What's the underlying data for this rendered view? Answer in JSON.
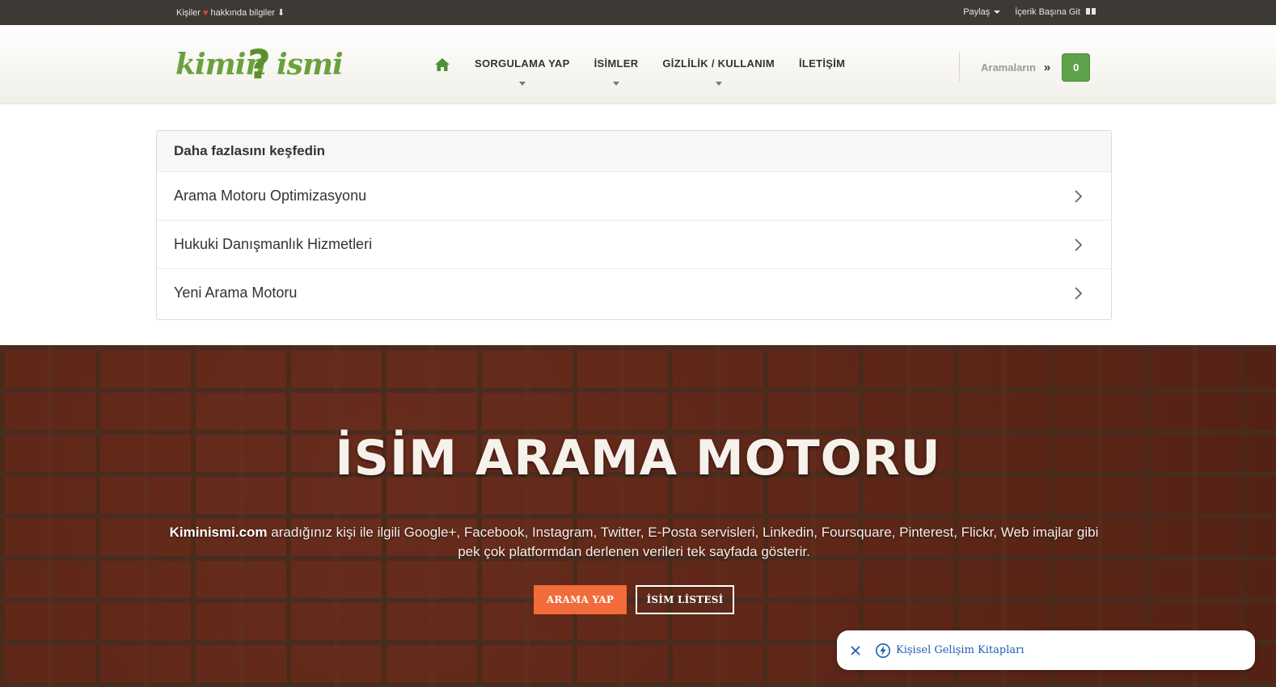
{
  "topbar": {
    "left_prefix": "Kişiler",
    "left_suffix": "hakkında bilgiler",
    "left_icon": "heart-icon",
    "left_arrow": "⬇",
    "share": "Paylaş",
    "go_top": "İçerik Başına Git",
    "go_top_icon": "book-icon"
  },
  "header": {
    "logo_left": "kimin",
    "logo_q": "?",
    "logo_right": "ismi",
    "nav": [
      {
        "label": "SORGULAMA YAP"
      },
      {
        "label": "İSİMLER"
      },
      {
        "label": "GİZLİLİK / KULLANIM"
      },
      {
        "label": "İLETİŞİM"
      }
    ],
    "searches_label": "Aramaların",
    "searches_raquo": "»",
    "searches_count": "0"
  },
  "discover": {
    "title": "Daha fazlasını keşfedin",
    "items": [
      {
        "label": "Arama Motoru Optimizasyonu"
      },
      {
        "label": "Hukuki Danışmanlık Hizmetleri"
      },
      {
        "label": "Yeni Arama Motoru"
      }
    ]
  },
  "hero": {
    "title": "İSİM ARAMA MOTORU",
    "brand": "Kiminismi.com",
    "description": "aradığınız kişi ile ilgili Google+, Facebook, Instagram, Twitter, E-Posta servisleri, Linkedin, Foursquare, Pinterest, Flickr, Web imajlar gibi pek çok platformdan derlenen verileri tek sayfada gösterir.",
    "btn_search": "ARAMA YAP",
    "btn_list": "İSİM LİSTESİ"
  },
  "adbar": {
    "text": "Kişisel Gelişim Kitapları"
  },
  "colors": {
    "topbar_bg": "#3d3a36",
    "logo_green": "#6aa13c",
    "count_green": "#5ea24a",
    "primary_orange": "#f26b3a",
    "hero_brick": "#6e2d1e",
    "ad_link_blue": "#1a5fb4"
  }
}
